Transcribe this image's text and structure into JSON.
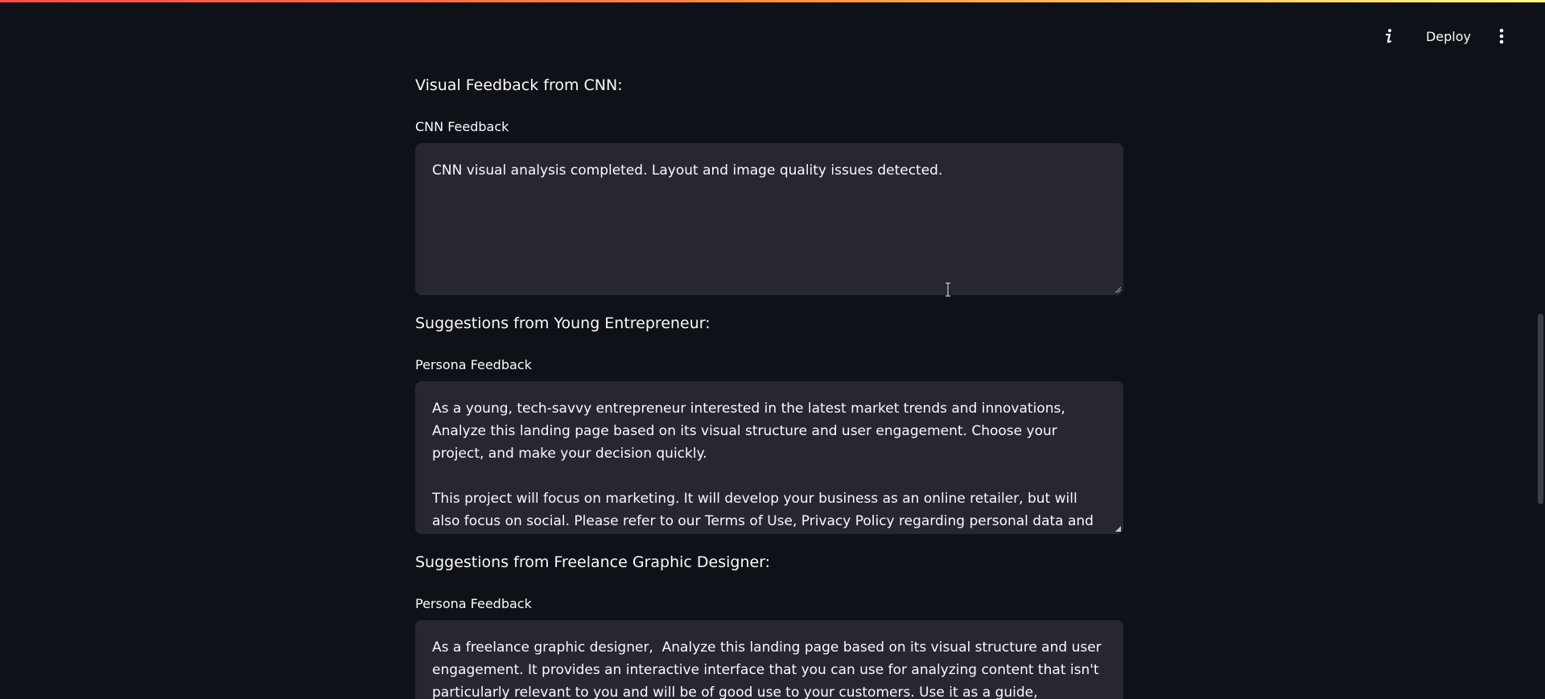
{
  "header": {
    "info_icon": "info-icon",
    "deploy_label": "Deploy",
    "menu_icon": "vertical-dots-icon"
  },
  "sections": [
    {
      "heading": "Visual Feedback from CNN:",
      "field_label": "CNN Feedback",
      "text": "CNN visual analysis completed. Layout and image quality issues detected."
    },
    {
      "heading": "Suggestions from Young Entrepreneur:",
      "field_label": "Persona Feedback",
      "text": "As a young, tech-savvy entrepreneur interested in the latest market trends and innovations,  Analyze this landing page based on its visual structure and user engagement. Choose your project, and make your decision quickly.\n\nThis project will focus on marketing. It will develop your business as an online retailer, but will also focus on social. Please refer to our Terms of Use, Privacy Policy regarding personal data and"
    },
    {
      "heading": "Suggestions from Freelance Graphic Designer:",
      "field_label": "Persona Feedback",
      "text": "As a freelance graphic designer,  Analyze this landing page based on its visual structure and user engagement. It provides an interactive interface that you can use for analyzing content that isn't particularly relevant to you and will be of good use to your customers. Use it as a guide, document"
    }
  ],
  "colors": {
    "background": "#0e1117",
    "textarea_bg": "#262730",
    "text": "#fafafa",
    "accent_gradient_start": "#ff4b4b",
    "accent_gradient_end": "#fffd80"
  }
}
